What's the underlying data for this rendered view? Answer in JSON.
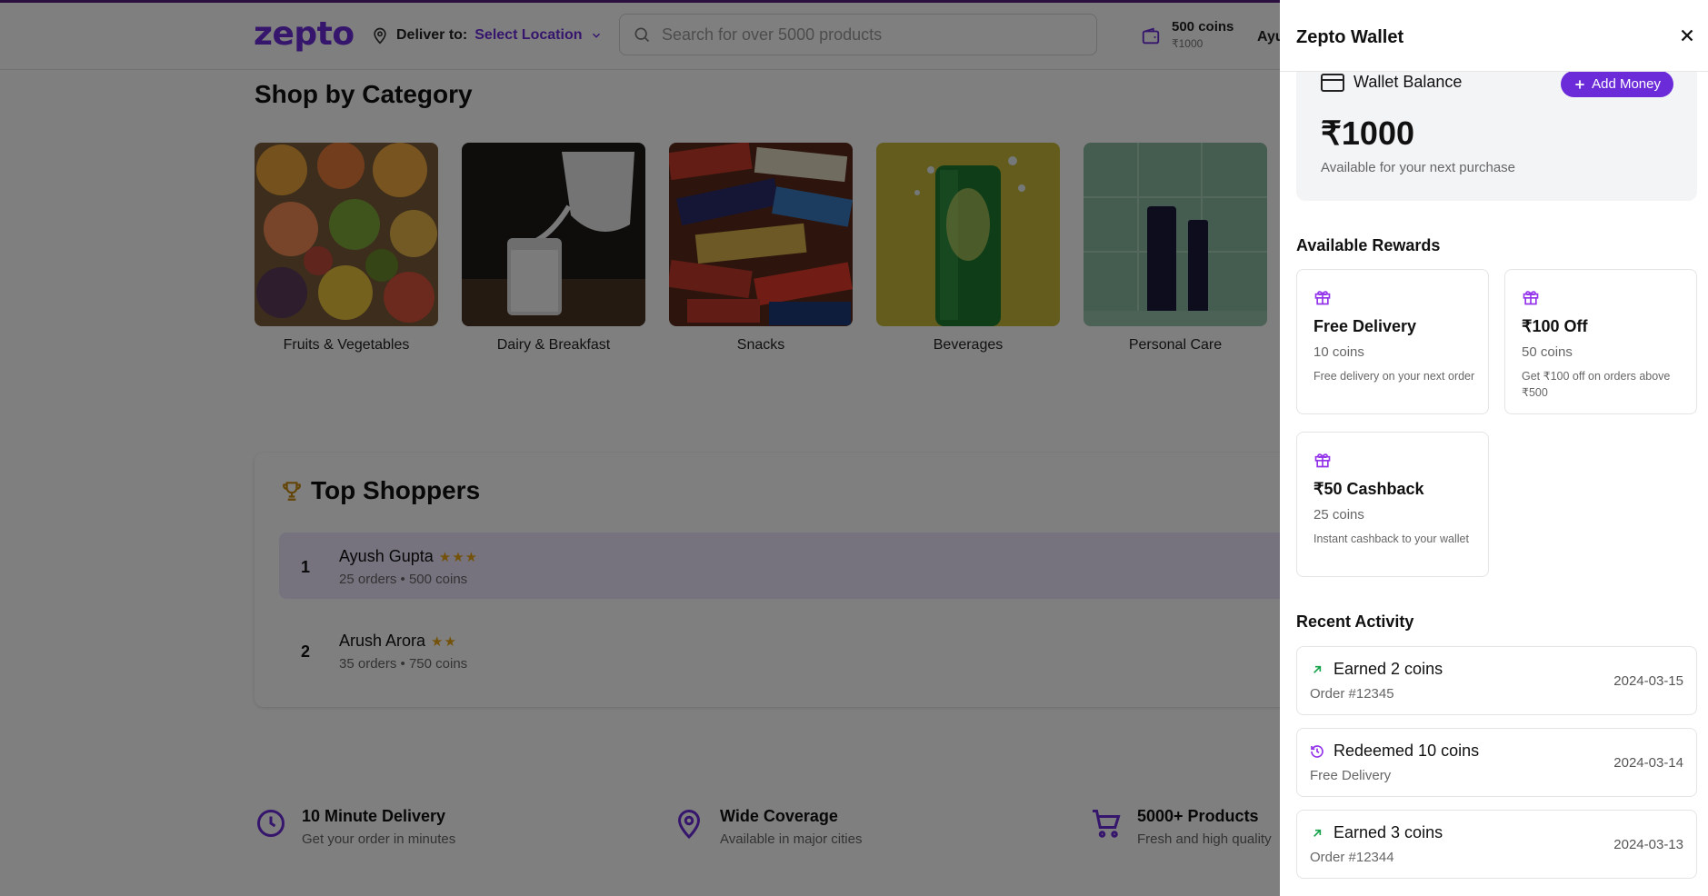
{
  "header": {
    "logo": "zepto",
    "deliver_label": "Deliver to:",
    "location": "Select Location",
    "search_placeholder": "Search for over 5000 products",
    "coins": "500 coins",
    "coins_value": "₹1000",
    "user_truncated": "Ayu"
  },
  "categories": {
    "title": "Shop by Category",
    "items": [
      {
        "name": "Fruits & Vegetables"
      },
      {
        "name": "Dairy & Breakfast"
      },
      {
        "name": "Snacks"
      },
      {
        "name": "Beverages"
      },
      {
        "name": "Personal Care"
      }
    ]
  },
  "top_shoppers": {
    "title": "Top Shoppers",
    "rows": [
      {
        "rank": "1",
        "name": "Ayush Gupta",
        "stars": "★★★",
        "detail": "25 orders • 500 coins"
      },
      {
        "rank": "2",
        "name": "Arush Arora",
        "stars": "★★",
        "detail": "35 orders • 750 coins"
      }
    ]
  },
  "features": [
    {
      "title": "10 Minute Delivery",
      "subtitle": "Get your order in minutes",
      "icon": "clock-icon"
    },
    {
      "title": "Wide Coverage",
      "subtitle": "Available in major cities",
      "icon": "map-pin-icon"
    },
    {
      "title": "5000+ Products",
      "subtitle": "Fresh and high quality",
      "icon": "cart-icon"
    }
  ],
  "wallet": {
    "title": "Zepto Wallet",
    "balance_label": "Wallet Balance",
    "add_money": "Add Money",
    "balance": "₹1000",
    "balance_note": "Available for your next purchase",
    "rewards_title": "Available Rewards",
    "rewards": [
      {
        "title": "Free Delivery",
        "coins": "10 coins",
        "desc": "Free delivery on your next order"
      },
      {
        "title": "₹100 Off",
        "coins": "50 coins",
        "desc": "Get ₹100 off on orders above ₹500"
      },
      {
        "title": "₹50 Cashback",
        "coins": "25 coins",
        "desc": "Instant cashback to your wallet"
      }
    ],
    "activity_title": "Recent Activity",
    "activity": [
      {
        "type": "earned",
        "icon": "arrow-up-right-icon",
        "title": "Earned 2 coins",
        "sub": "Order #12345",
        "date": "2024-03-15"
      },
      {
        "type": "redeemed",
        "icon": "history-icon",
        "title": "Redeemed 10 coins",
        "sub": "Free Delivery",
        "date": "2024-03-14"
      },
      {
        "type": "earned",
        "icon": "arrow-up-right-icon",
        "title": "Earned 3 coins",
        "sub": "Order #12344",
        "date": "2024-03-13"
      }
    ]
  },
  "colors": {
    "brand": "#6c2bd9",
    "earned": "#16a34a",
    "redeemed": "#9333ea",
    "star": "#e8a515"
  }
}
